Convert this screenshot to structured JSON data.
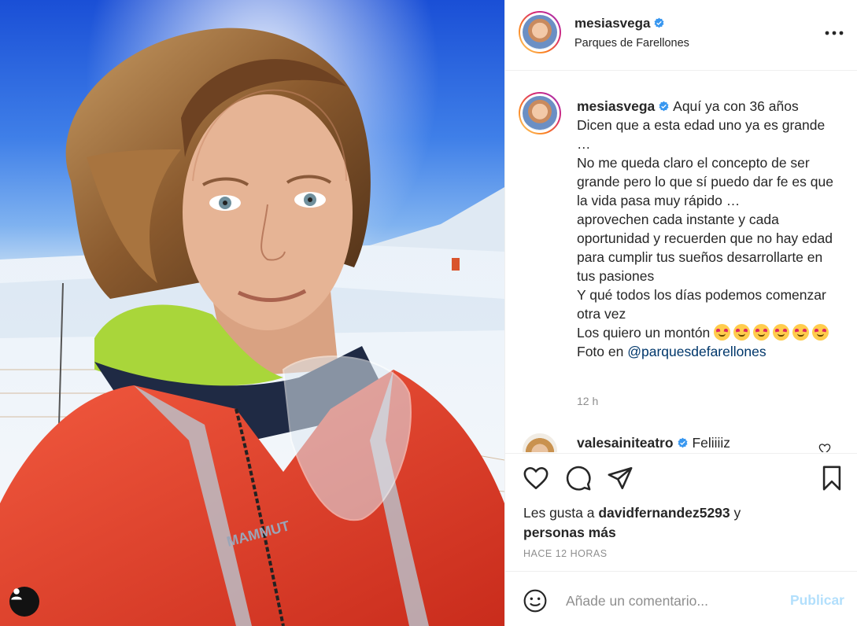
{
  "post": {
    "username": "mesiasvega",
    "location": "Parques de Farellones",
    "verified": true
  },
  "caption": {
    "username": "mesiasvega",
    "text": "Aquí ya con 36 años\nDicen que a esta edad uno ya es grande …\nNo me queda claro el concepto de ser grande pero lo que sí puedo dar fe es que la vida pasa muy rápido …\naprovechen cada instante y cada oportunidad y recuerden que no hay edad para cumplir tus sueños desarrollarte en tus pasiones\nY qué todos los días podemos comenzar otra vez\nLos quiero un montón",
    "emoji_name": "smiling-face-with-hearts",
    "emoji_count": 6,
    "photo_prefix": "Foto en",
    "photo_link": "@parquesdefarellones",
    "time": "12 h"
  },
  "comments": [
    {
      "username": "valesainiteatro",
      "verified": true,
      "text": "Feliiiiz"
    }
  ],
  "likes": {
    "prefix": "Les gusta a",
    "user": "davidfernandez5293",
    "conjunction": "y",
    "others": "personas más"
  },
  "timestamp": "HACE 12 HORAS",
  "comment_input": {
    "placeholder": "Añade un comentario..."
  },
  "publish_label": "Publicar",
  "colors": {
    "verified": "#3897f0",
    "link": "#00376b",
    "publish_disabled": "#b2dffc",
    "jacket": "#e8402c",
    "sky": "#2f6fe0"
  },
  "icons": [
    "more-options-icon",
    "heart-icon",
    "comment-icon",
    "share-icon",
    "bookmark-icon",
    "smile-emoji-icon",
    "user-tag-icon",
    "verified-badge-icon"
  ]
}
